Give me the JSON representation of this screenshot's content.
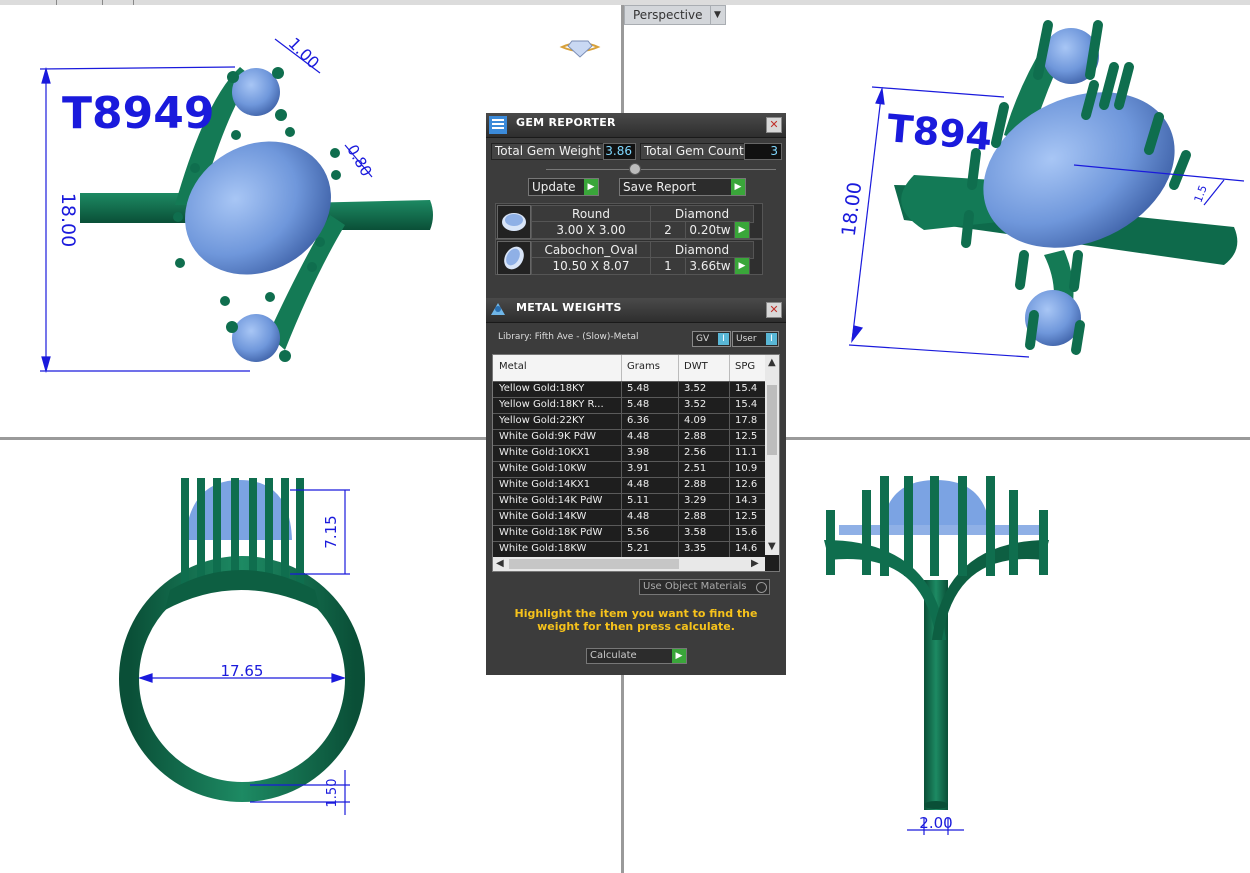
{
  "viewports": {
    "top_right_label": "Perspective"
  },
  "model": {
    "id_text": "T8949",
    "dims": {
      "top_left_height": "18.00",
      "top_left_small": "1.00",
      "top_left_prong": "0.80",
      "top_right_height": "18.00",
      "top_right_small": "1.5",
      "front_inner": "17.65",
      "front_height": "7.15",
      "front_band": "1.50",
      "side_shank": "2.00"
    }
  },
  "gem_reporter": {
    "title": "GEM REPORTER",
    "total_weight_label": "Total Gem Weight",
    "total_weight_value": "3.86",
    "total_count_label": "Total Gem Count",
    "total_count_value": "3",
    "update_label": "Update",
    "save_label": "Save Report",
    "gems": [
      {
        "cut": "Round",
        "type": "Diamond",
        "size": "3.00 X 3.00",
        "qty": "2",
        "weight": "0.20tw"
      },
      {
        "cut": "Cabochon_Oval",
        "type": "Diamond",
        "size": "10.50 X 8.07",
        "qty": "1",
        "weight": "3.66tw"
      }
    ]
  },
  "metal_weights": {
    "title": "METAL WEIGHTS",
    "library": "Library: Fifth Ave - (Slow)-Metal",
    "toggle_gv": "GV",
    "toggle_user": "User",
    "columns": [
      "Metal",
      "Grams",
      "DWT",
      "SPG"
    ],
    "rows": [
      [
        "Yellow Gold:18KY",
        "5.48",
        "3.52",
        "15.4"
      ],
      [
        "Yellow Gold:18KY R...",
        "5.48",
        "3.52",
        "15.4"
      ],
      [
        "Yellow Gold:22KY",
        "6.36",
        "4.09",
        "17.8"
      ],
      [
        "White Gold:9K PdW",
        "4.48",
        "2.88",
        "12.5"
      ],
      [
        "White Gold:10KX1",
        "3.98",
        "2.56",
        "11.1"
      ],
      [
        "White Gold:10KW",
        "3.91",
        "2.51",
        "10.9"
      ],
      [
        "White Gold:14KX1",
        "4.48",
        "2.88",
        "12.6"
      ],
      [
        "White Gold:14K PdW",
        "5.11",
        "3.29",
        "14.3"
      ],
      [
        "White Gold:14KW",
        "4.48",
        "2.88",
        "12.5"
      ],
      [
        "White Gold:18K PdW",
        "5.56",
        "3.58",
        "15.6"
      ],
      [
        "White Gold:18KW",
        "5.21",
        "3.35",
        "14.6"
      ]
    ],
    "use_object_materials": "Use Object Materials",
    "message": "Highlight the item you want to find the weight for then press calculate.",
    "calculate_label": "Calculate"
  },
  "colors": {
    "metal": "#0f6e4e",
    "gem": "#7ba3e3",
    "dimension": "#1a1adc",
    "panel": "#3c3c3c",
    "highlight_text": "#f6c21b"
  }
}
